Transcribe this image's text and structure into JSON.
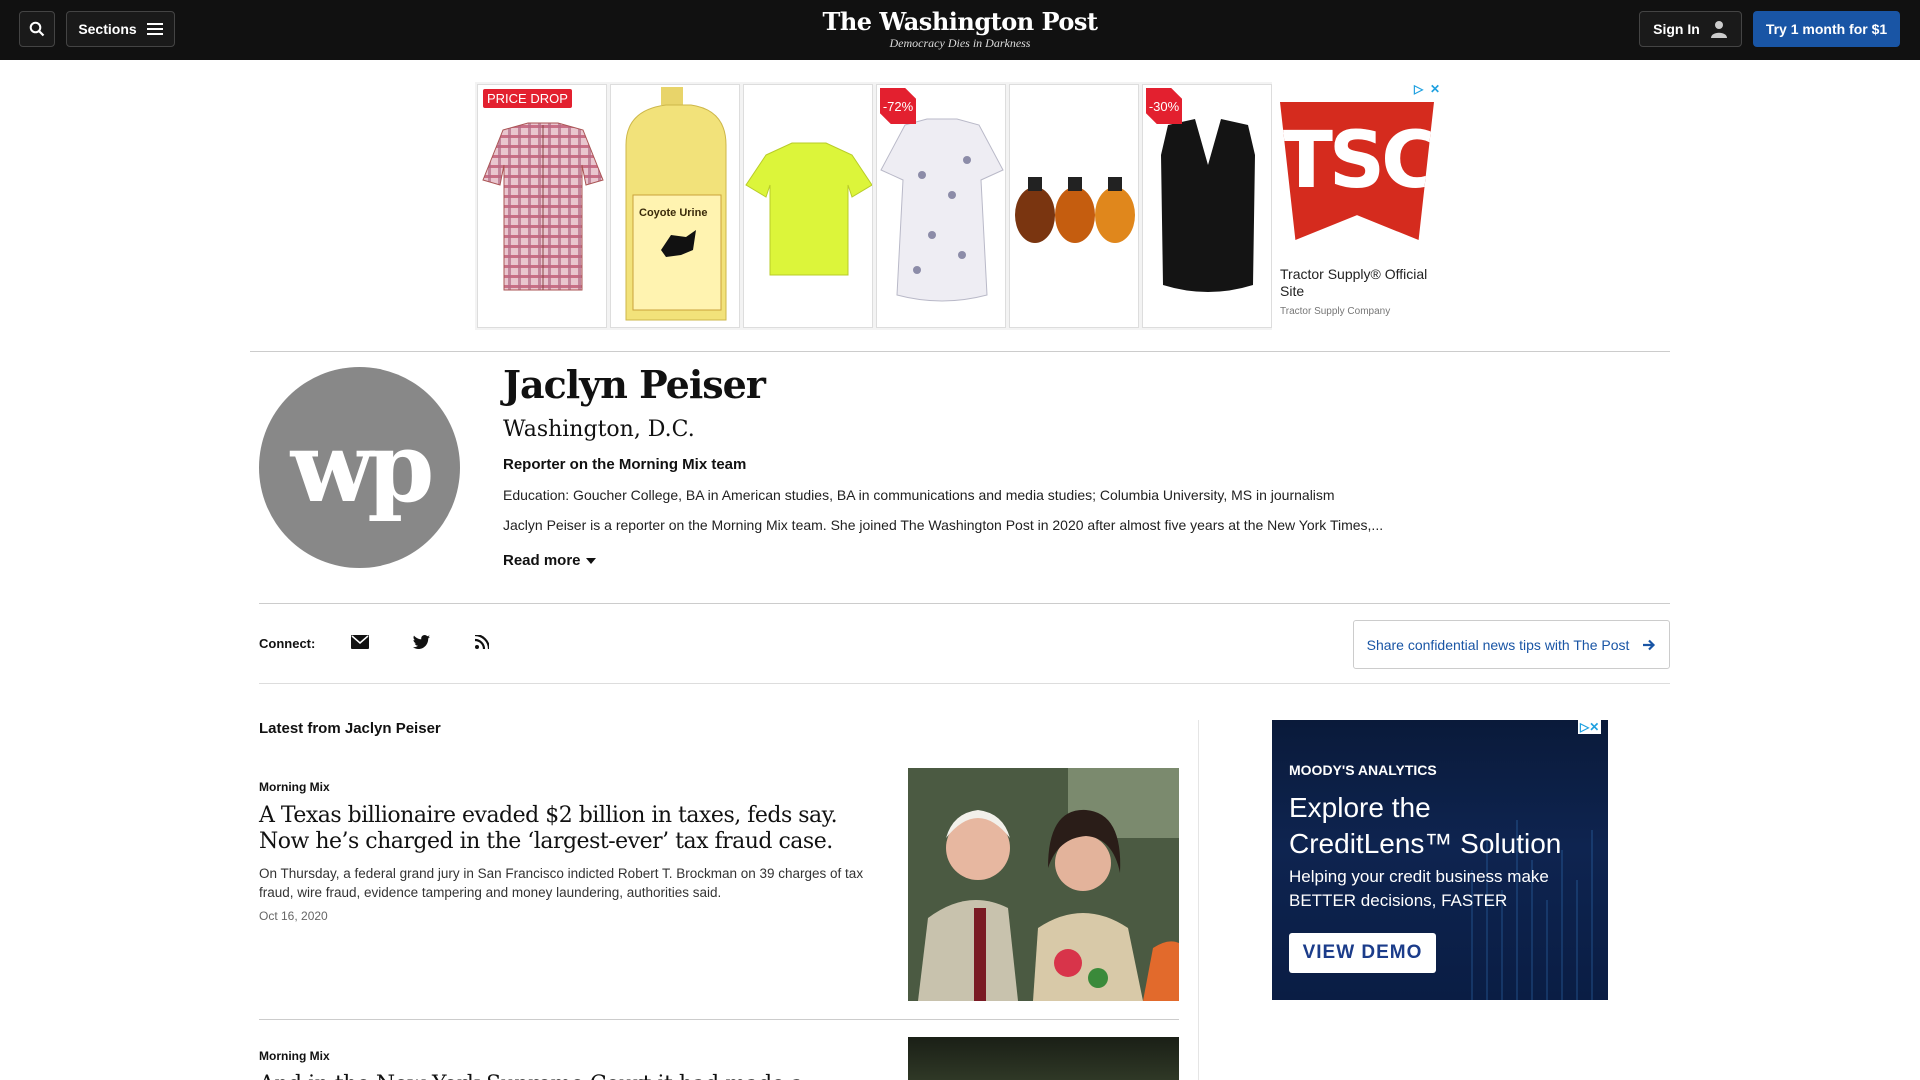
{
  "header": {
    "sections_label": "Sections",
    "logo": "The Washington Post",
    "tagline": "Democracy Dies in Darkness",
    "signin_label": "Sign In",
    "trial_label": "Try 1 month for $1"
  },
  "top_ad": {
    "tile_badges": [
      "PRICE DROP",
      "-72%",
      "-30%"
    ],
    "tsc_logo_text": "TSC",
    "tsc_title": "Tractor Supply® Official Site",
    "tsc_sub": "Tractor Supply Company",
    "jug_label": "Coyote Urine"
  },
  "profile": {
    "avatar_text": "wp",
    "name": "Jaclyn Peiser",
    "location": "Washington, D.C.",
    "role": "Reporter on the Morning Mix team",
    "education": "Education: Goucher College, BA in American studies, BA in communications and media studies; Columbia University, MS in journalism",
    "bio": "Jaclyn Peiser is a reporter on the Morning Mix team. She joined The Washington Post in 2020 after almost five years at the New York Times,...",
    "read_more": "Read more"
  },
  "connect": {
    "label": "Connect:",
    "tips_label": "Share confidential news tips with The Post"
  },
  "latest": {
    "heading": "Latest from Jaclyn Peiser",
    "articles": [
      {
        "kicker": "Morning Mix",
        "headline": "A Texas billionaire evaded $2 billion in taxes, feds say. Now he’s charged in the ‘largest-ever’ tax fraud case.",
        "blurb": "On Thursday, a federal grand jury in San Francisco indicted Robert T. Brockman on 39 charges of tax fraud, wire fraud, evidence tampering and money laundering, authorities said.",
        "date": "Oct 16, 2020"
      },
      {
        "kicker": "Morning Mix",
        "headline": "And in the New York Supreme Court it had made a landing"
      }
    ]
  },
  "right_ad": {
    "brand": "MOODY'S ANALYTICS",
    "headline_line1": "Explore the",
    "headline_line2": "CreditLens™ Solution",
    "sub": "Helping your credit business make BETTER decisions, FASTER",
    "cta": "VIEW DEMO"
  }
}
